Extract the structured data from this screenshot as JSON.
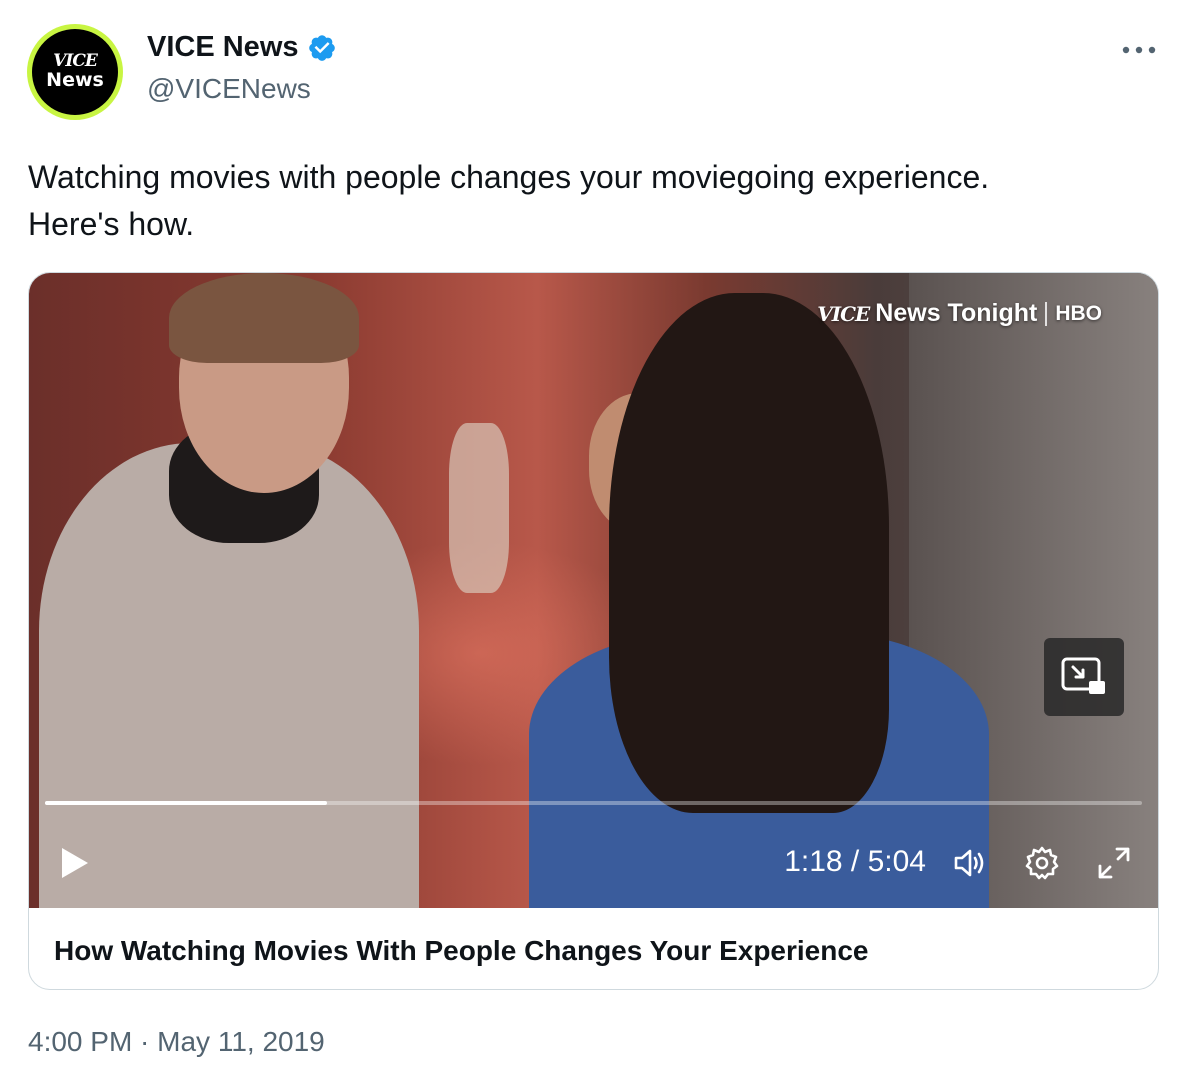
{
  "author": {
    "avatar_line1": "VICE",
    "avatar_line2": "News",
    "display_name": "VICE News",
    "handle": "@VICENews",
    "verified": true
  },
  "more_icon": "more-horizontal-icon",
  "tweet": {
    "text_line1": "Watching movies with people changes your moviegoing experience.",
    "text_line2": "Here's how.",
    "timestamp": "4:00 PM · May 11, 2019"
  },
  "video": {
    "watermark_brand": "VICE",
    "watermark_show": "News Tonight",
    "watermark_network": "HBO",
    "current_time": "1:18",
    "duration": "5:04",
    "time_display": "1:18 / 5:04",
    "progress_fraction": 0.257,
    "icons": [
      "play-icon",
      "volume-icon",
      "settings-icon",
      "fullscreen-icon",
      "picture-in-picture-icon"
    ]
  },
  "card": {
    "title": "How Watching Movies With People Changes Your Experience"
  },
  "colors": {
    "avatar_ring": "#c8f542",
    "verified_blue": "#1d9bf0",
    "secondary_text": "#536471",
    "primary_text": "#0f1419",
    "card_border": "#cfd9de"
  }
}
